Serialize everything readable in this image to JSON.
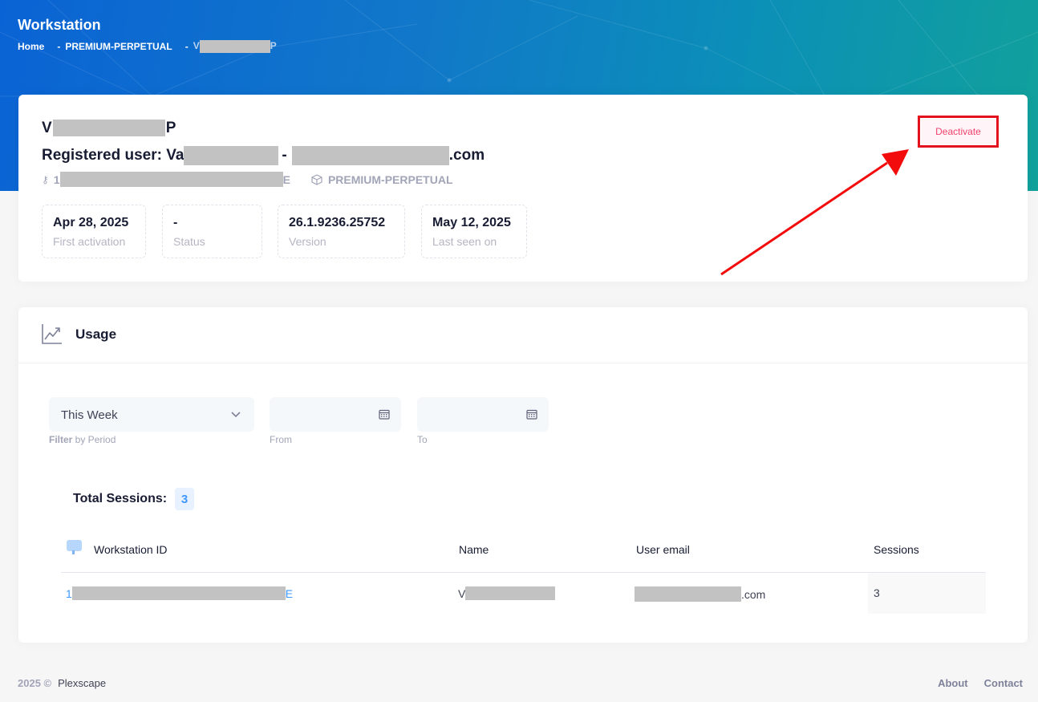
{
  "header": {
    "title": "Workstation",
    "breadcrumb": {
      "home": "Home",
      "product": "PREMIUM-PERPETUAL",
      "current_prefix": "V",
      "current_suffix": "P"
    }
  },
  "device": {
    "name_prefix": "V",
    "name_suffix": "P",
    "registered_label": "Registered user: Va",
    "registered_sep": "-",
    "email_suffix": ".com",
    "workstation_id_prefix": "1",
    "workstation_id_suffix": "E",
    "license": "PREMIUM-PERPETUAL",
    "deactivate_label": "Deactivate"
  },
  "stats": [
    {
      "value": "Apr 28, 2025",
      "label": "First activation"
    },
    {
      "value": "-",
      "label": "Status"
    },
    {
      "value": "26.1.9236.25752",
      "label": "Version"
    },
    {
      "value": "May 12, 2025",
      "label": "Last seen on"
    }
  ],
  "usage": {
    "title": "Usage",
    "period": {
      "selected": "This Week",
      "hint_bold": "Filter",
      "hint_rest": " by Period"
    },
    "from_label": "From",
    "to_label": "To",
    "total_label": "Total Sessions:",
    "total_value": "3",
    "columns": [
      "Workstation ID",
      "Name",
      "User email",
      "Sessions"
    ],
    "row": {
      "id_prefix": "1",
      "id_suffix": "E",
      "name_prefix": "V",
      "email_suffix": ".com",
      "sessions": "3"
    }
  },
  "footer": {
    "year": "2025 ©",
    "brand": "Plexscape",
    "links": [
      "About",
      "Contact"
    ]
  },
  "colors": {
    "accent": "#3e97ff",
    "danger": "#f1416c",
    "highlight": "#e3101e"
  }
}
